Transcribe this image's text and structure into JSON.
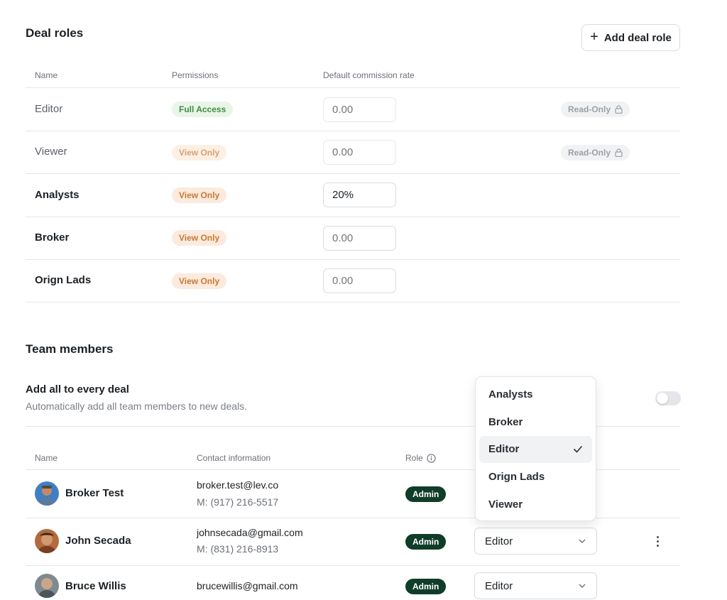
{
  "deal_roles": {
    "title": "Deal roles",
    "add_button": "Add deal role",
    "columns": {
      "name": "Name",
      "permissions": "Permissions",
      "rate": "Default commission rate"
    },
    "rows": [
      {
        "name": "Editor",
        "permission": "Full Access",
        "rate_value": "",
        "rate_placeholder": "0.00",
        "badge": "Read-Only"
      },
      {
        "name": "Viewer",
        "permission": "View Only",
        "rate_value": "",
        "rate_placeholder": "0.00",
        "badge": "Read-Only"
      },
      {
        "name": "Analysts",
        "permission": "View Only",
        "rate_value": "20%",
        "rate_placeholder": "0.00",
        "badge": ""
      },
      {
        "name": "Broker",
        "permission": "View Only",
        "rate_value": "",
        "rate_placeholder": "0.00",
        "badge": ""
      },
      {
        "name": "Orign Lads",
        "permission": "View Only",
        "rate_value": "",
        "rate_placeholder": "0.00",
        "badge": ""
      }
    ]
  },
  "team_members": {
    "title": "Team members",
    "auto_add": {
      "label": "Add all to every deal",
      "description": "Automatically add all team members to new deals.",
      "enabled": false
    },
    "columns": {
      "name": "Name",
      "contact": "Contact information",
      "role": "Role"
    },
    "rows": [
      {
        "name": "Broker Test",
        "email": "broker.test@lev.co",
        "phone": "M: (917) 216-5517",
        "badge": "Admin",
        "role": "Editor"
      },
      {
        "name": "John Secada",
        "email": "johnsecada@gmail.com",
        "phone": "M: (831) 216-8913",
        "badge": "Admin",
        "role": "Editor"
      },
      {
        "name": "Bruce Willis",
        "email": "brucewillis@gmail.com",
        "phone": "",
        "badge": "Admin",
        "role": "Editor"
      }
    ],
    "role_dropdown": {
      "options": [
        "Analysts",
        "Broker",
        "Editor",
        "Orign Lads",
        "Viewer"
      ],
      "selected": "Editor"
    }
  },
  "colors": {
    "admin_badge": "#103c2a",
    "full_access_bg": "#eaf5ea",
    "view_only_bg": "#fbeadd"
  },
  "icons": [
    "plus-icon",
    "lock-icon",
    "info-icon",
    "chevron-down-icon",
    "check-icon",
    "more-vertical-icon"
  ]
}
